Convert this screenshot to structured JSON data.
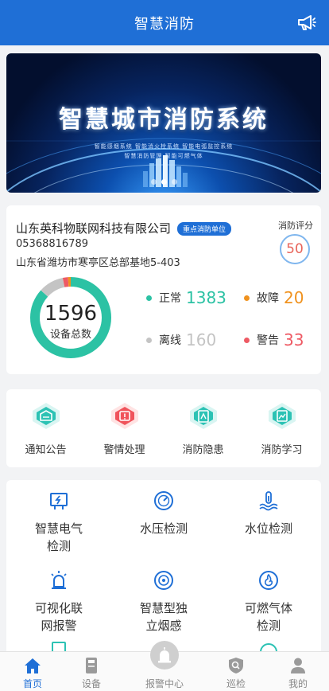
{
  "header": {
    "title": "智慧消防",
    "icon": "megaphone-icon"
  },
  "banner": {
    "title": "智慧城市消防系统",
    "subtitle_line1": "智能感烟系统    智能消火栓系统    智能电弧监控系统",
    "subtitle_line2": "智慧消防管理    智能可燃气体",
    "slide_count": 3,
    "active_slide": 1
  },
  "company": {
    "name": "山东英科物联网科技有限公司",
    "tag": "重点消防单位",
    "phone": "05368816789",
    "address": "山东省潍坊市寒亭区总部基地5-403",
    "score_label": "消防评分",
    "score": "50"
  },
  "devices": {
    "total": "1596",
    "total_label": "设备总数",
    "stats": [
      {
        "label": "正常",
        "value": "1383",
        "color": "#2cc2a4"
      },
      {
        "label": "故障",
        "value": "20",
        "color": "#f0921e"
      },
      {
        "label": "离线",
        "value": "160",
        "color": "#c4c4c4"
      },
      {
        "label": "警告",
        "value": "33",
        "color": "#ee5a64"
      }
    ]
  },
  "quick_actions": [
    {
      "label": "通知公告",
      "icon": "notice-icon"
    },
    {
      "label": "警情处理",
      "icon": "alarm-handle-icon"
    },
    {
      "label": "消防隐患",
      "icon": "hazard-icon"
    },
    {
      "label": "消防学习",
      "icon": "study-icon"
    }
  ],
  "functions": [
    {
      "label_line1": "智慧电气",
      "label_line2": "检测",
      "icon": "electric-icon"
    },
    {
      "label_line1": "水压检测",
      "label_line2": "",
      "icon": "pressure-gauge-icon"
    },
    {
      "label_line1": "水位检测",
      "label_line2": "",
      "icon": "water-level-icon"
    },
    {
      "label_line1": "可视化联",
      "label_line2": "网报警",
      "icon": "siren-icon"
    },
    {
      "label_line1": "智慧型独",
      "label_line2": "立烟感",
      "icon": "smoke-detector-icon"
    },
    {
      "label_line1": "可燃气体",
      "label_line2": "检测",
      "icon": "gas-icon"
    }
  ],
  "tabs": [
    {
      "label": "首页",
      "icon": "home-icon",
      "active": true
    },
    {
      "label": "设备",
      "icon": "device-icon",
      "active": false
    },
    {
      "label": "报警中心",
      "icon": "alarm-icon",
      "active": false
    },
    {
      "label": "巡检",
      "icon": "inspection-icon",
      "active": false
    },
    {
      "label": "我的",
      "icon": "user-icon",
      "active": false
    }
  ]
}
